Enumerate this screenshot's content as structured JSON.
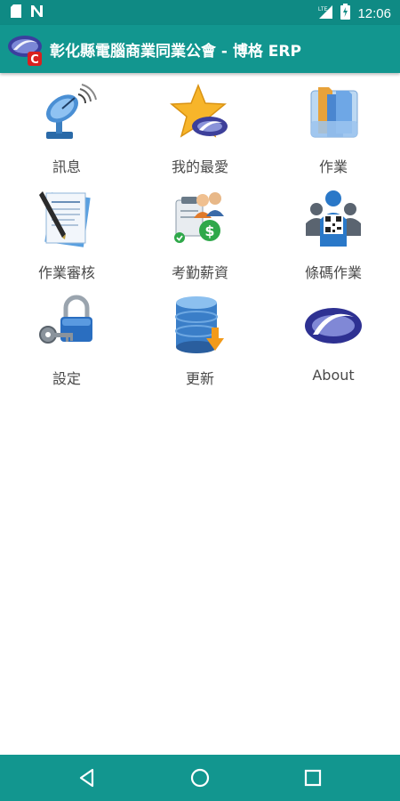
{
  "status_bar": {
    "time": "12:06",
    "left_icons": [
      "sd-card-icon",
      "n-notification-icon"
    ],
    "right_icons": [
      "lte-signal-icon",
      "battery-charging-icon"
    ]
  },
  "app_bar": {
    "title": "彰化縣電腦商業同業公會 - 博格 ERP",
    "logo_icon": "app-logo-icon"
  },
  "menu": {
    "items": [
      {
        "label": "訊息",
        "icon": "satellite-dish-icon"
      },
      {
        "label": "我的最愛",
        "icon": "star-icon"
      },
      {
        "label": "作業",
        "icon": "folders-icon"
      },
      {
        "label": "作業審核",
        "icon": "document-pen-icon"
      },
      {
        "label": "考勤薪資",
        "icon": "payroll-icon"
      },
      {
        "label": "條碼作業",
        "icon": "barcode-people-icon"
      },
      {
        "label": "設定",
        "icon": "lock-key-icon"
      },
      {
        "label": "更新",
        "icon": "database-download-icon"
      },
      {
        "label": "About",
        "icon": "app-swoosh-icon"
      }
    ]
  },
  "nav_bar": {
    "buttons": [
      "back-icon",
      "home-icon",
      "recents-icon"
    ]
  },
  "colors": {
    "primary": "#12968f",
    "status_bar": "#0f8a84",
    "label_text": "#4a4a4a"
  }
}
